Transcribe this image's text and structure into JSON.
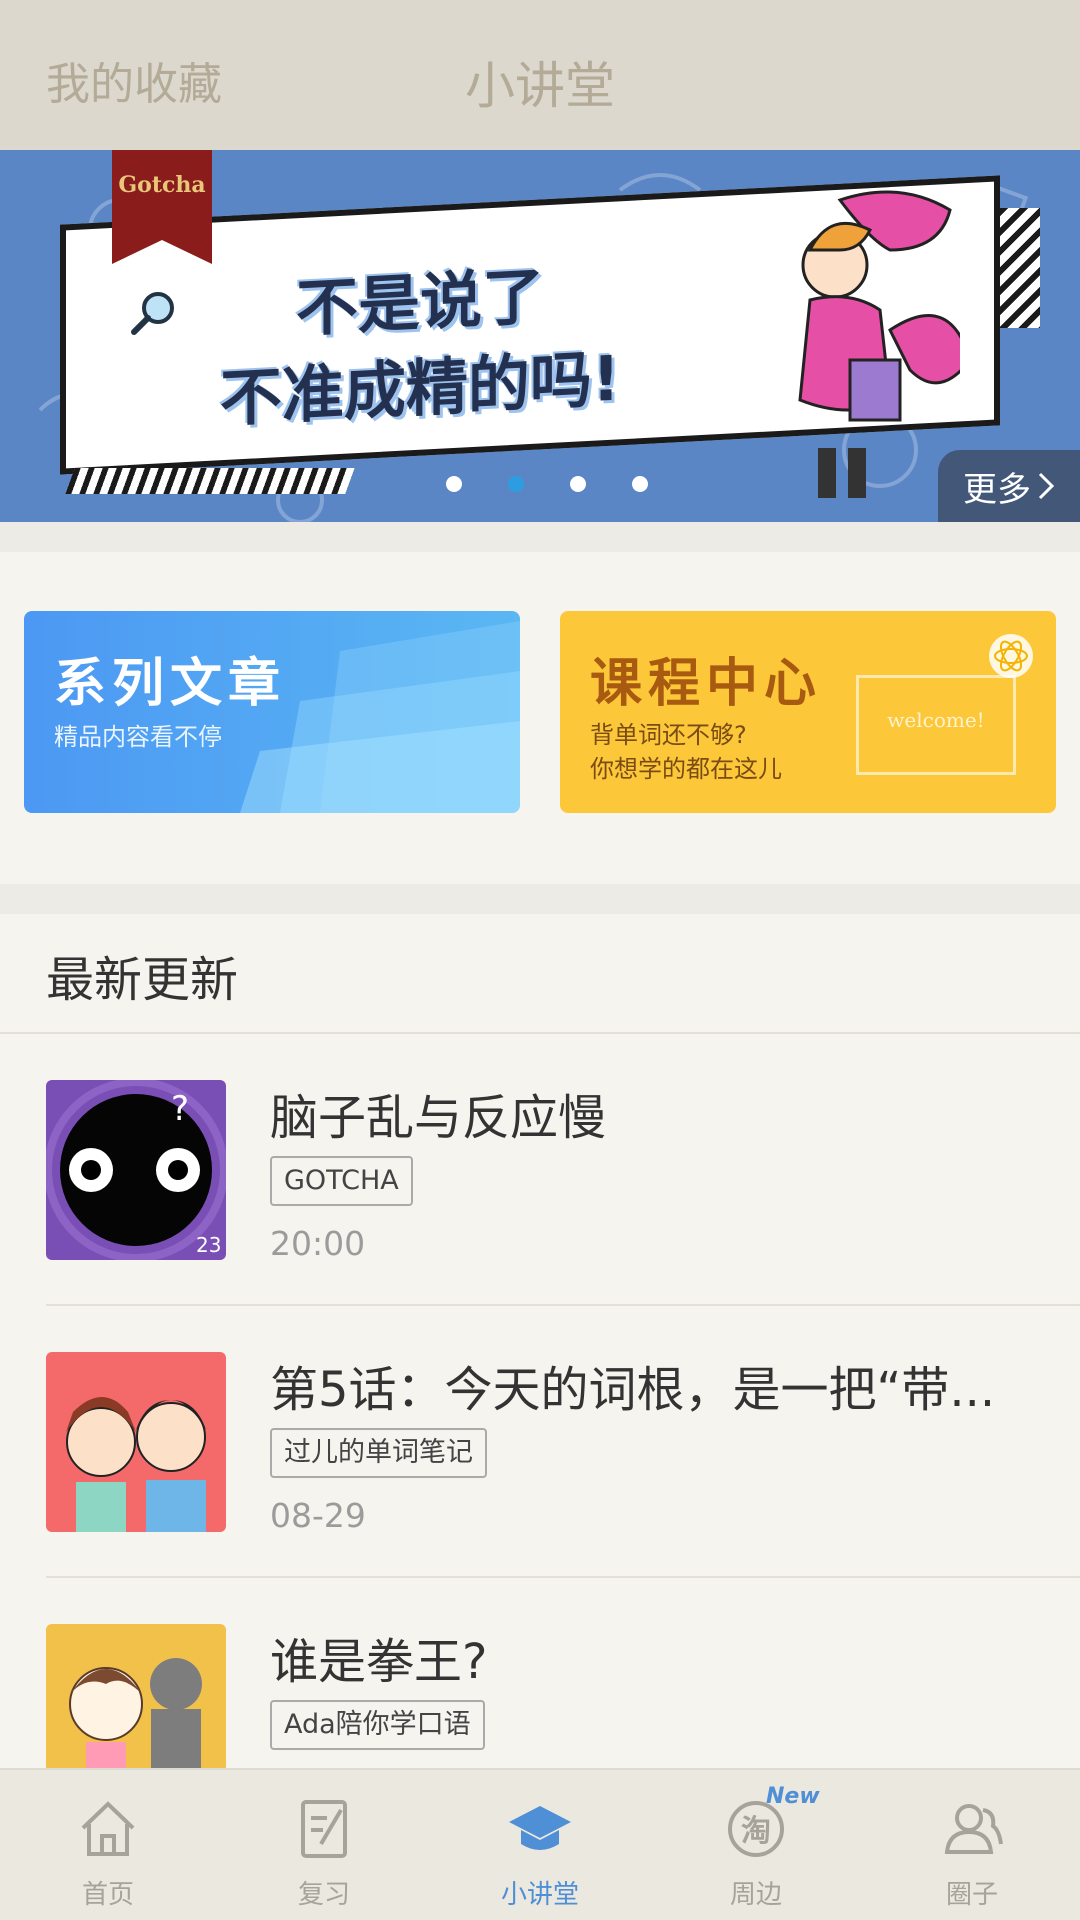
{
  "topbar": {
    "left_label": "我的收藏",
    "title": "小讲堂"
  },
  "banner": {
    "ribbon_text": "Gotcha",
    "line1": "不是说了",
    "line2": "不准成精的吗!",
    "more_label": "更多",
    "active_dot": 1,
    "dot_count": 4
  },
  "cards": {
    "series": {
      "title": "系列文章",
      "subtitle": "精品内容看不停"
    },
    "courses": {
      "title": "课程中心",
      "subtitle1": "背单词还不够?",
      "subtitle2": "你想学的都在这儿",
      "board_text": "welcome!"
    }
  },
  "latest": {
    "section_title": "最新更新",
    "items": [
      {
        "title": "脑子乱与反应慢",
        "tag": "GOTCHA",
        "date": "20:00",
        "thumb_badge": "23",
        "thumb_icon": "eyes-character-icon"
      },
      {
        "title": "第5话：今天的词根，是一把“带...",
        "tag": "过儿的单词笔记",
        "date": "08-29",
        "thumb_icon": "two-girls-illustration"
      },
      {
        "title": "谁是拳王?",
        "tag": "Ada陪你学口语",
        "date": "",
        "thumb_icon": "boxing-illustration"
      }
    ]
  },
  "bottom_nav": {
    "items": [
      {
        "label": "首页",
        "icon": "home-icon"
      },
      {
        "label": "复习",
        "icon": "review-icon"
      },
      {
        "label": "小讲堂",
        "icon": "graduation-cap-icon",
        "active": true
      },
      {
        "label": "周边",
        "icon": "tao-icon",
        "badge": "New"
      },
      {
        "label": "圈子",
        "icon": "people-icon"
      }
    ]
  },
  "colors": {
    "accent": "#4f8fd6",
    "banner_bg": "#5a86c6",
    "dot_active": "#2d9de2",
    "series_card": "#4c98f3",
    "course_card": "#fcc83a"
  }
}
